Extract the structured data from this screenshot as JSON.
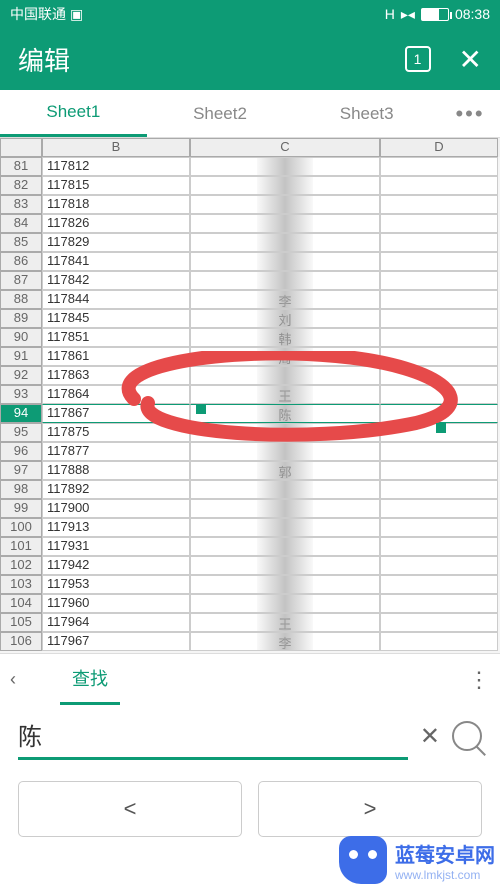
{
  "status_bar": {
    "carrier": "中国联通",
    "network": "H",
    "signal": "▸◂",
    "time": "08:38"
  },
  "app_bar": {
    "title": "编辑",
    "tab_counter": "1"
  },
  "sheet_tabs": {
    "items": [
      {
        "label": "Sheet1",
        "active": true
      },
      {
        "label": "Sheet2",
        "active": false
      },
      {
        "label": "Sheet3",
        "active": false
      }
    ],
    "more": "•••"
  },
  "columns": [
    "B",
    "C",
    "D"
  ],
  "rows": [
    {
      "num": 81,
      "b": "117812",
      "c": ""
    },
    {
      "num": 82,
      "b": "117815",
      "c": ""
    },
    {
      "num": 83,
      "b": "117818",
      "c": ""
    },
    {
      "num": 84,
      "b": "117826",
      "c": ""
    },
    {
      "num": 85,
      "b": "117829",
      "c": ""
    },
    {
      "num": 86,
      "b": "117841",
      "c": ""
    },
    {
      "num": 87,
      "b": "117842",
      "c": ""
    },
    {
      "num": 88,
      "b": "117844",
      "c": "李"
    },
    {
      "num": 89,
      "b": "117845",
      "c": "刘"
    },
    {
      "num": 90,
      "b": "117851",
      "c": "韩"
    },
    {
      "num": 91,
      "b": "117861",
      "c": "周"
    },
    {
      "num": 92,
      "b": "117863",
      "c": ""
    },
    {
      "num": 93,
      "b": "117864",
      "c": "王"
    },
    {
      "num": 94,
      "b": "117867",
      "c": "陈",
      "selected": true
    },
    {
      "num": 95,
      "b": "117875",
      "c": ""
    },
    {
      "num": 96,
      "b": "117877",
      "c": ""
    },
    {
      "num": 97,
      "b": "117888",
      "c": "郭"
    },
    {
      "num": 98,
      "b": "117892",
      "c": ""
    },
    {
      "num": 99,
      "b": "117900",
      "c": ""
    },
    {
      "num": 100,
      "b": "117913",
      "c": ""
    },
    {
      "num": 101,
      "b": "117931",
      "c": ""
    },
    {
      "num": 102,
      "b": "117942",
      "c": ""
    },
    {
      "num": 103,
      "b": "117953",
      "c": ""
    },
    {
      "num": 104,
      "b": "117960",
      "c": ""
    },
    {
      "num": 105,
      "b": "117964",
      "c": "王"
    },
    {
      "num": 106,
      "b": "117967",
      "c": "李"
    }
  ],
  "find_bar": {
    "back": "‹",
    "mode": "查找",
    "more": "⋮"
  },
  "search": {
    "value": "陈",
    "clear": "✕"
  },
  "nav": {
    "prev": "<",
    "next": ">"
  },
  "watermark": {
    "line1": "蓝莓安卓网",
    "line2": "www.lmkjst.com"
  }
}
